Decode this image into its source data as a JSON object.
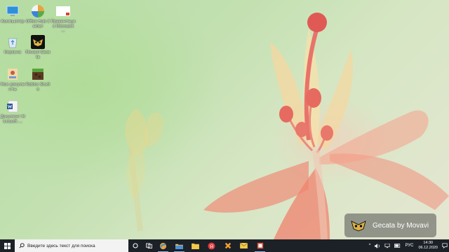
{
  "desktop": {
    "icons": [
      {
        "label": "Компьютер",
        "icon": "computer-icon"
      },
      {
        "label": "Office Hub Center",
        "icon": "office-hub-icon"
      },
      {
        "label": "Презентация Microsoft ...",
        "icon": "presentation-file-icon"
      },
      {
        "label": "Корзина",
        "icon": "recycle-bin-icon"
      },
      {
        "label": "Movavi Gecata",
        "icon": "gecata-icon"
      },
      {
        "label": "Мои документы",
        "icon": "my-documents-icon"
      },
      {
        "label": "Roblox Studio",
        "icon": "roblox-icon"
      },
      {
        "label": "Документ Microsoft ...",
        "icon": "word-document-icon"
      }
    ]
  },
  "watermark": {
    "text": "Gecata by Movavi"
  },
  "taskbar": {
    "search_placeholder": "Введите здесь текст для поиска",
    "pinned": [
      {
        "name": "cortana-button",
        "icon": "circle-icon"
      },
      {
        "name": "task-view-button",
        "icon": "task-view-icon"
      },
      {
        "name": "browser-button",
        "icon": "browser-icon"
      },
      {
        "name": "file-explorer-button",
        "icon": "folder-icon"
      },
      {
        "name": "yandex-button",
        "icon": "yandex-icon"
      },
      {
        "name": "app-x-button",
        "icon": "orange-x-icon"
      },
      {
        "name": "mail-button",
        "icon": "mail-icon"
      },
      {
        "name": "office-button",
        "icon": "office-icon"
      }
    ],
    "tray": {
      "language": "РУС",
      "time": "14:30",
      "date": "06.12.2020"
    }
  },
  "colors": {
    "taskbar_bg": "#1c2027",
    "accent": "#8ab4e8"
  }
}
